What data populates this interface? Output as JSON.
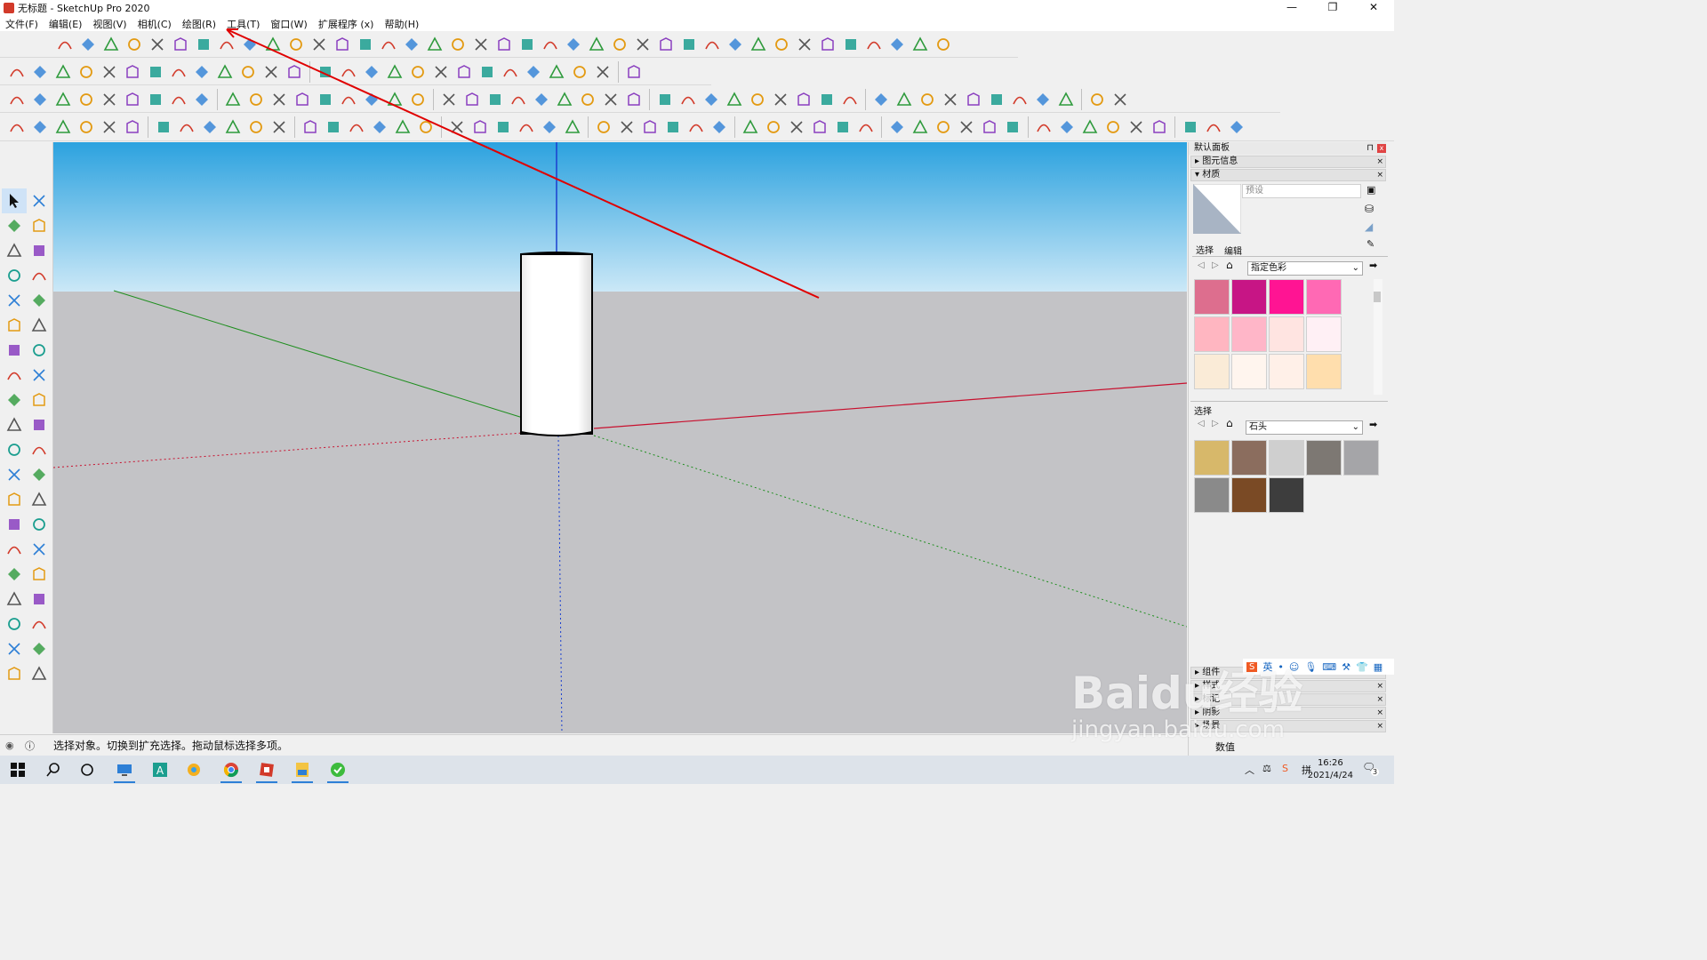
{
  "window": {
    "title": "无标题 - SketchUp Pro 2020",
    "controls": [
      "—",
      "❐",
      "✕"
    ]
  },
  "menu": [
    "文件(F)",
    "编辑(E)",
    "视图(V)",
    "相机(C)",
    "绘图(R)",
    "工具(T)",
    "窗口(W)",
    "扩展程序 (x)",
    "帮助(H)"
  ],
  "right_panel": {
    "title": "默认面板",
    "entity_info": "图元信息",
    "materials": "材质",
    "material_name_placeholder": "预设",
    "tab_select": "选择",
    "tab_edit": "编辑",
    "library_1": "指定色彩",
    "swatches_1": [
      "#dd6e8e",
      "#c71585",
      "#ff1493",
      "#ff69b4",
      "#ffb6c1",
      "#ffb6c8",
      "#ffe4e1",
      "#fff0f5",
      "#faebd7",
      "#fff5ee",
      "#fff0e8",
      "#ffdead"
    ],
    "select_label_2": "选择",
    "library_2": "石头",
    "swatches_2": [
      "#d7b86a",
      "#8b6d5e",
      "#cfcfcf",
      "#7d7873",
      "#a5a5a8",
      "#8a8a8a",
      "#7a4a25",
      "#3d3d3d"
    ],
    "collapsed_sections": [
      "组件",
      "样式",
      "标记",
      "阴影",
      "场景"
    ]
  },
  "status": {
    "hint": "选择对象。切换到扩充选择。拖动鼠标选择多项。",
    "measure_label": "数值"
  },
  "taskbar": {
    "time": "16:26",
    "date": "2021/4/24",
    "notification_count": "3"
  },
  "watermark": {
    "main": "Baidu经验",
    "sub": "jingyan.baidu.com"
  },
  "ime": {
    "label": "英"
  },
  "colors": {
    "sky_top": "#2ca2df",
    "sky_bottom": "#cbe8f7",
    "ground": "#c3c3c6",
    "axis_red": "#c8102e",
    "axis_green": "#1e8e1e",
    "axis_blue": "#1a3fd0",
    "annotation": "#e00000"
  }
}
